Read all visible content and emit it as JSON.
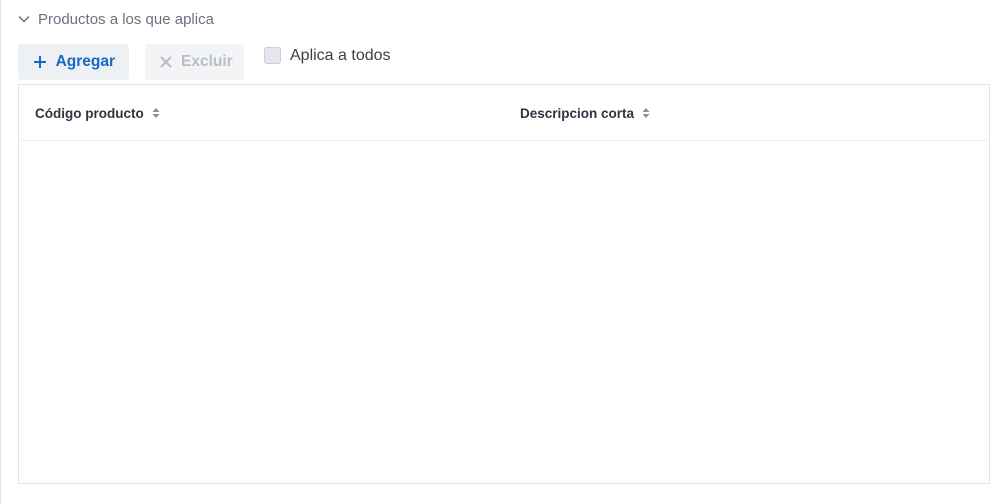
{
  "section": {
    "title": "Productos a los que aplica",
    "collapse_icon": "chevron-down-icon"
  },
  "toolbar": {
    "add_label": "Agregar",
    "add_icon": "plus-icon",
    "exclude_label": "Excluir",
    "exclude_icon": "close-icon",
    "exclude_enabled": false
  },
  "apply_all": {
    "label": "Aplica a todos",
    "checked": false
  },
  "table": {
    "columns": [
      {
        "label": "Código producto",
        "sort_icon": "sort-icon"
      },
      {
        "label": "Descripcion corta",
        "sort_icon": "sort-icon"
      }
    ],
    "rows": []
  },
  "colors": {
    "accent": "#1668c7",
    "disabled_text": "#b8bdc6",
    "muted_text": "#6b7280",
    "button_bg": "#eef1f4"
  }
}
